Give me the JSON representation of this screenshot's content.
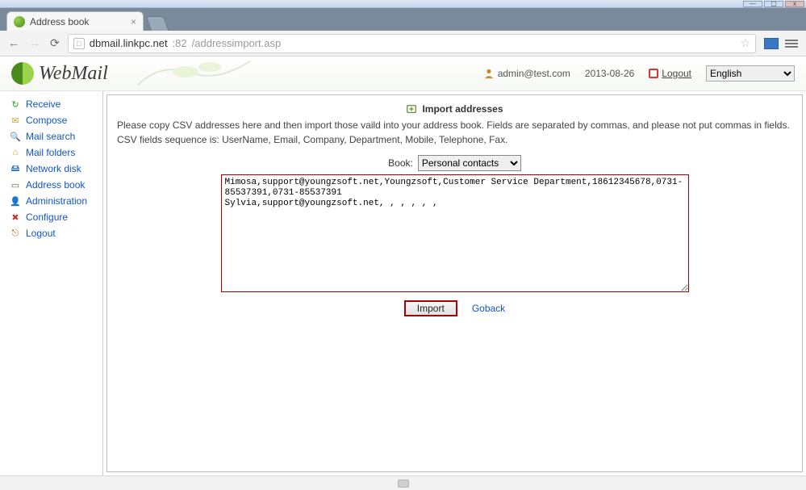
{
  "os": {
    "min": "—",
    "max": "▢",
    "close": "x"
  },
  "browser": {
    "tab_title": "Address book",
    "url_host": "dbmail.linkpc.net",
    "url_port": ":82",
    "url_path": "/addressimport.asp"
  },
  "header": {
    "brand": "WebMail",
    "user": "admin@test.com",
    "date": "2013-08-26",
    "logout": "Logout",
    "language_selected": "English"
  },
  "sidebar": {
    "items": [
      {
        "label": "Receive",
        "icon": "↻",
        "color": "#2a9d2a"
      },
      {
        "label": "Compose",
        "icon": "✉",
        "color": "#d79a2b"
      },
      {
        "label": "Mail search",
        "icon": "🔍",
        "color": "#3a77c4"
      },
      {
        "label": "Mail folders",
        "icon": "⌂",
        "color": "#d79a2b"
      },
      {
        "label": "Network disk",
        "icon": "🖴",
        "color": "#3a77c4"
      },
      {
        "label": "Address book",
        "icon": "▭",
        "color": "#7a5b3a"
      },
      {
        "label": "Administration",
        "icon": "👤",
        "color": "#c58a2e"
      },
      {
        "label": "Configure",
        "icon": "✖",
        "color": "#c03a2e"
      },
      {
        "label": "Logout",
        "icon": "⎋",
        "color": "#d35400"
      }
    ]
  },
  "page": {
    "title": "Import addresses",
    "instructions": "Please copy CSV addresses here and then import those vaild into your address book.  Fields are separated by commas, and please not put commas in fields.  CSV fields sequence is: UserName, Email, Company, Department, Mobile, Telephone, Fax.",
    "book_label": "Book:",
    "book_selected": "Personal contacts",
    "textarea_value": "Mimosa,support@youngzsoft.net,Youngzsoft,Customer Service Department,18612345678,0731-85537391,0731-85537391\nSylvia,support@youngzsoft.net, , , , , ,",
    "import_button": "Import",
    "goback": "Goback"
  }
}
